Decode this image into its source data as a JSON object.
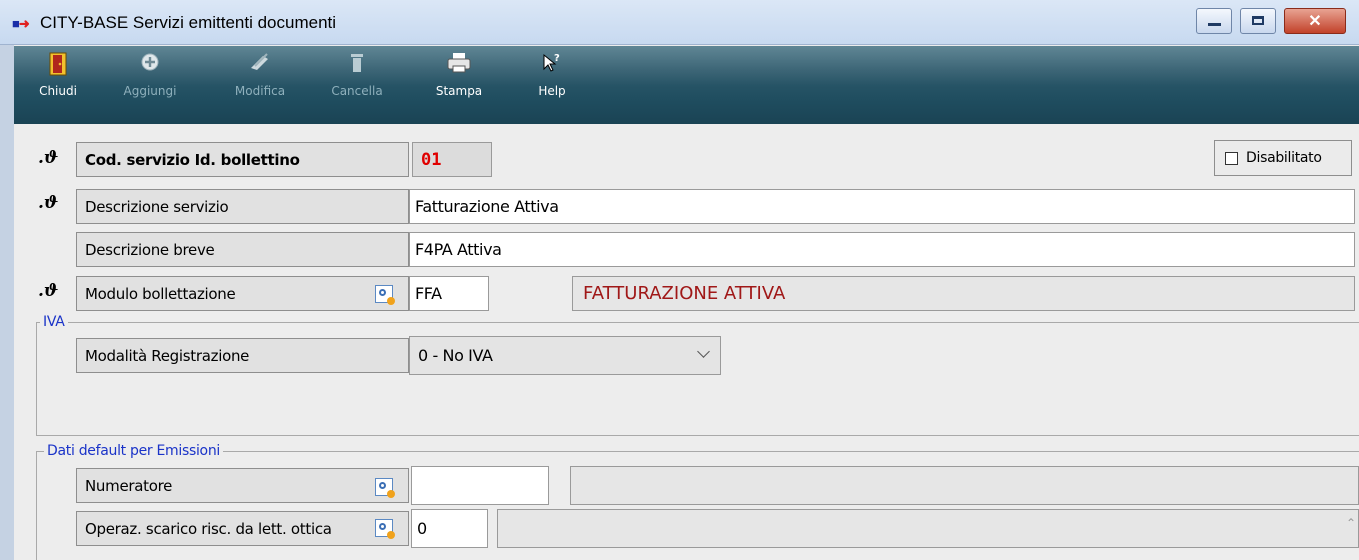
{
  "window": {
    "title": "CITY-BASE  Servizi emittenti documenti",
    "icon": "app-arrow-icon",
    "controls": {
      "minimize": "minimize-icon",
      "maximize": "maximize-icon",
      "close": "close-icon"
    }
  },
  "toolbar": {
    "items": [
      {
        "label": "Chiudi",
        "icon": "door-exit-icon",
        "enabled": true
      },
      {
        "label": "Aggiungi",
        "icon": "plus-circle-icon",
        "enabled": false
      },
      {
        "label": "Modifica",
        "icon": "edit-icon",
        "enabled": false
      },
      {
        "label": "Cancella",
        "icon": "trash-icon",
        "enabled": false
      },
      {
        "label": "Stampa",
        "icon": "printer-icon",
        "enabled": true
      },
      {
        "label": "Help",
        "icon": "help-cursor-icon",
        "enabled": true
      }
    ]
  },
  "form": {
    "cod_servizio": {
      "label": "Cod. servizio Id. bollettino",
      "value": "01"
    },
    "disabilitato": {
      "label": "Disabilitato",
      "checked": false
    },
    "descrizione_servizio": {
      "label": "Descrizione servizio",
      "value": "Fatturazione Attiva"
    },
    "descrizione_breve": {
      "label": "Descrizione breve",
      "value": "F4PA Attiva"
    },
    "modulo_bollettazione": {
      "label": "Modulo bollettazione",
      "code": "FFA",
      "description": "FATTURAZIONE  ATTIVA"
    }
  },
  "iva": {
    "title": "IVA",
    "modalita_registrazione": {
      "label": "Modalità Registrazione",
      "selected": "0 - No IVA"
    }
  },
  "emissioni": {
    "title": "Dati default per Emissioni",
    "numeratore": {
      "label": "Numeratore",
      "value": "",
      "description": ""
    },
    "operaz_scarico": {
      "label": "Operaz. scarico risc. da lett. ottica",
      "value": "0",
      "description": ""
    }
  },
  "colors": {
    "toolbar": "#2e5a6c",
    "accent_red": "#e00000",
    "group_title": "#1a33c8",
    "description_red": "#a01818"
  }
}
